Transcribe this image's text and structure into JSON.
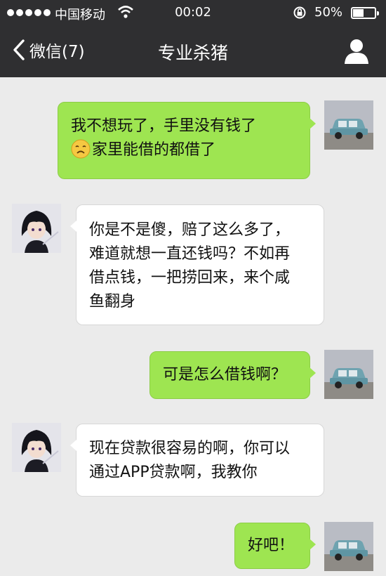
{
  "status_bar": {
    "carrier": "中国移动",
    "time": "00:02",
    "battery_text": "50%",
    "battery_level": 0.5
  },
  "nav": {
    "back_label": "微信(7)",
    "title": "专业杀猪"
  },
  "messages": [
    {
      "side": "sent",
      "lines": [
        "我不想玩了，手里没有钱了",
        "家里能借的都借了"
      ],
      "emoji": "sad-face-emoji"
    },
    {
      "side": "received",
      "lines": [
        "你是不是傻，赔了这么多了，",
        "难道就想一直还钱吗？不如再",
        "借点钱，一把捞回来，来个咸",
        "鱼翻身"
      ]
    },
    {
      "side": "sent",
      "lines": [
        "可是怎么借钱啊？"
      ]
    },
    {
      "side": "received",
      "lines": [
        "现在贷款很容易的啊，你可以",
        "通过APP贷款啊，我教你"
      ]
    },
    {
      "side": "sent",
      "lines": [
        "好吧！"
      ]
    }
  ]
}
